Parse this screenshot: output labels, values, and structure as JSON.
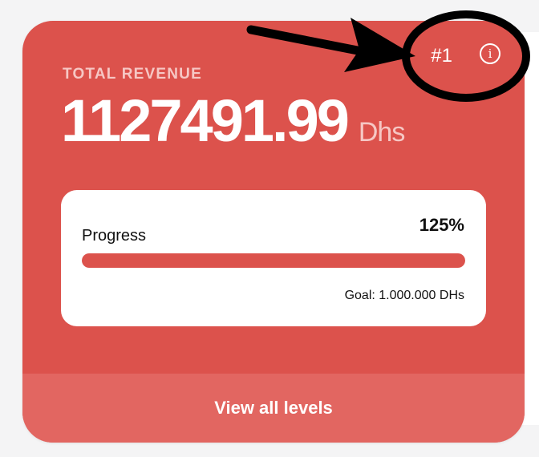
{
  "card": {
    "rank": "#1",
    "info_icon": "info-icon",
    "label": "TOTAL REVENUE",
    "value": "1127491.99",
    "unit": "Dhs",
    "progress": {
      "title": "Progress",
      "percent_text": "125%",
      "fill_fraction": 1.0,
      "goal_text": "Goal: 1.000.000 DHs"
    },
    "footer_button": "View all levels"
  },
  "colors": {
    "card_bg": "#dc524c",
    "footer_bg": "#e26661",
    "label_muted": "#f6c7c4",
    "annotation": "#000000"
  },
  "annotation": {
    "shape": "ellipse",
    "arrow": true,
    "target": "rank-and-info"
  }
}
